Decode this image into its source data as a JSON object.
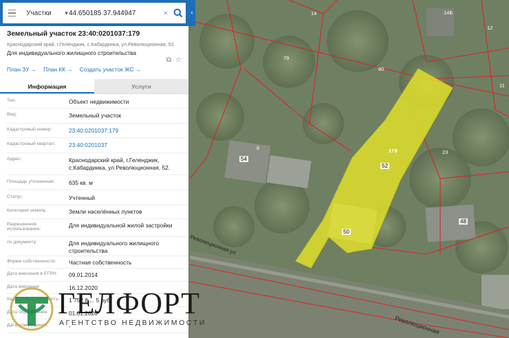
{
  "search": {
    "type_label": "Участки",
    "query": "44.650185 37.944947"
  },
  "parcel": {
    "title": "Земельный участок 23:40:0201037:179",
    "address_line": "Краснодарский край, г.Геленджик, с.Кабардинка, ул.Революционная, 52.",
    "purpose": "Для индивидуального жилищного строительства",
    "links": [
      "План ЗУ",
      "План КК",
      "Создать участок ЖС"
    ]
  },
  "tabs": [
    {
      "label": "Информация",
      "active": true
    },
    {
      "label": "Услуги",
      "active": false
    }
  ],
  "info_rows": [
    {
      "label": "Тип:",
      "value": "Объект недвижимости"
    },
    {
      "label": "Вид:",
      "value": "Земельный участок"
    },
    {
      "label": "Кадастровый номер:",
      "value": "23:40:0201037:179",
      "link": true
    },
    {
      "label": "Кадастровый квартал:",
      "value": "23:40:0201037",
      "link": true
    },
    {
      "label": "Адрес:",
      "value": "Краснодарский край, г.Геленджик, с.Кабардинка, ул.Революционная, 52."
    },
    {
      "label": "Площадь уточненная:",
      "value": "635 кв. м"
    },
    {
      "label": "Статус:",
      "value": "Учтенный"
    },
    {
      "label": "Категория земель:",
      "value": "Земли населённых пунктов"
    },
    {
      "label": "Разрешенное использование:",
      "value": "Для индивидуальной жилой застройки"
    },
    {
      "label": "по документу:",
      "value": "Для индивидуального жилищного строительства"
    },
    {
      "label": "Форма собственности:",
      "value": "Частная собственность"
    },
    {
      "label": "Дата внесения в ЕГРН:",
      "value": "09.01.2014"
    },
    {
      "label": "Дата внесения:",
      "value": "16.12.2020"
    },
    {
      "label": "Кадастровая стоимость:",
      "value": "1 752 8 ... 5 руб."
    },
    {
      "label": "Дата определения:",
      "value": "01.01.2020"
    },
    {
      "label": "Дата утверждения:",
      "value": "-"
    }
  ],
  "map": {
    "parcel_labels": [
      "14",
      "14Б",
      "12",
      "79",
      "80",
      "11",
      "6",
      "54",
      "179",
      "23",
      "52",
      "48",
      "50"
    ],
    "street_labels": [
      "Революционная ул",
      "Революционная"
    ],
    "selected_color": "#e4e32a",
    "boundary_color": "#d8262a"
  },
  "logo": {
    "name": "ГЕЛФОРТ",
    "subtitle": "АГЕНТСТВО НЕДВИЖИМОСТИ",
    "brand_color": "#1f8f4a"
  },
  "colors": {
    "accent": "#1e6fb9",
    "link": "#1d6fbd"
  }
}
